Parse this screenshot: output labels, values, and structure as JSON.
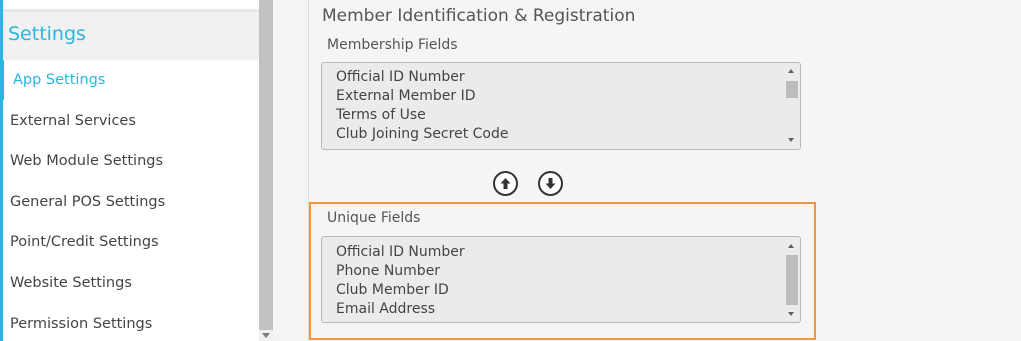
{
  "sidebar": {
    "header": "Settings",
    "items": [
      {
        "label": "App Settings",
        "active": true
      },
      {
        "label": "External Services",
        "active": false
      },
      {
        "label": "Web Module Settings",
        "active": false
      },
      {
        "label": "General POS Settings",
        "active": false
      },
      {
        "label": "Point/Credit Settings",
        "active": false
      },
      {
        "label": "Website Settings",
        "active": false
      },
      {
        "label": "Permission Settings",
        "active": false
      }
    ]
  },
  "main": {
    "section_title": "Member Identification & Registration",
    "membership_fields": {
      "label": "Membership Fields",
      "options": [
        "Official ID Number",
        "External Member ID",
        "Terms of Use",
        "Club Joining Secret Code"
      ]
    },
    "move_buttons": {
      "up_icon": "arrow-up-circle-icon",
      "down_icon": "arrow-down-circle-icon"
    },
    "unique_fields": {
      "label": "Unique Fields",
      "options": [
        "Official ID Number",
        "Phone Number",
        "Club Member ID",
        "Email Address"
      ]
    }
  },
  "colors": {
    "accent": "#29b6e0",
    "highlight": "#f0963c"
  }
}
